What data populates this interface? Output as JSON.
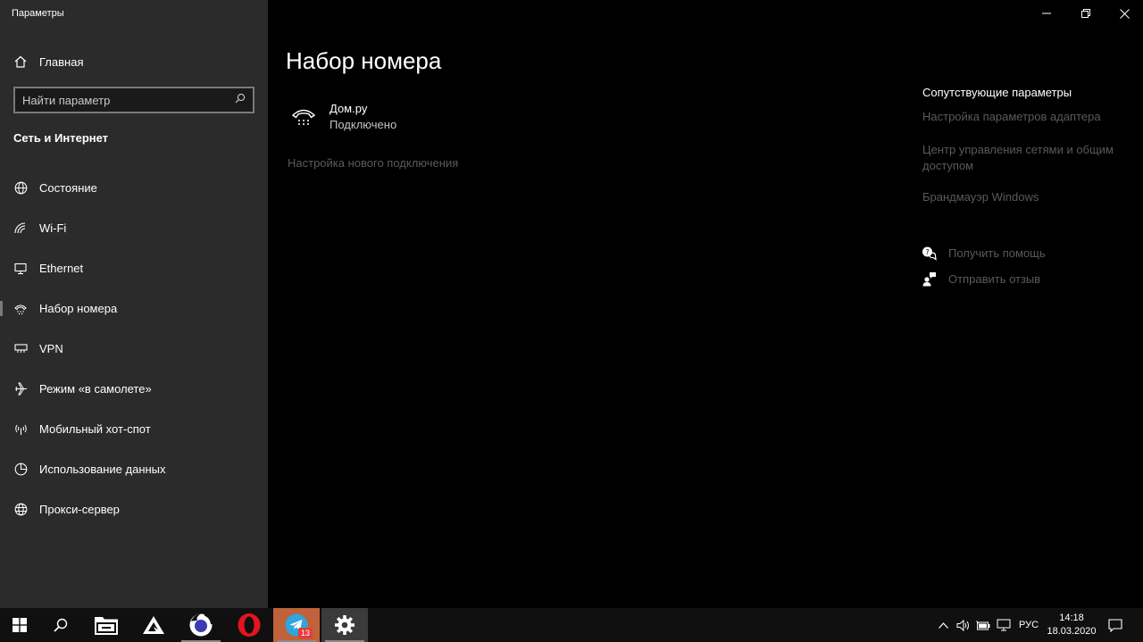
{
  "window": {
    "title": "Параметры"
  },
  "sidebar": {
    "home_label": "Главная",
    "search_placeholder": "Найти параметр",
    "section_title": "Сеть и Интернет",
    "items": [
      {
        "label": "Состояние",
        "icon": "globe-icon"
      },
      {
        "label": "Wi-Fi",
        "icon": "wifi-icon"
      },
      {
        "label": "Ethernet",
        "icon": "ethernet-icon"
      },
      {
        "label": "Набор номера",
        "icon": "dialup-icon",
        "selected": true
      },
      {
        "label": "VPN",
        "icon": "vpn-icon"
      },
      {
        "label": "Режим «в самолете»",
        "icon": "airplane-icon"
      },
      {
        "label": "Мобильный хот-спот",
        "icon": "hotspot-icon"
      },
      {
        "label": "Использование данных",
        "icon": "data-usage-icon"
      },
      {
        "label": "Прокси-сервер",
        "icon": "proxy-globe-icon"
      }
    ]
  },
  "main": {
    "title": "Набор номера",
    "connection": {
      "name": "Дом.ру",
      "status": "Подключено",
      "icon": "dialup-phone-icon"
    },
    "new_connection_link": "Настройка нового подключения"
  },
  "related": {
    "title": "Сопутствующие параметры",
    "links": [
      "Настройка параметров адаптера",
      "Центр управления сетями и общим доступом",
      "Брандмауэр Windows"
    ],
    "help_label": "Получить помощь",
    "feedback_label": "Отправить отзыв"
  },
  "taskbar": {
    "apps": [
      "start-icon",
      "search-icon",
      "file-explorer-icon",
      "aimp-icon",
      "firefox-icon",
      "opera-icon",
      "telegram-icon",
      "settings-icon"
    ],
    "telegram_badge": "13",
    "language": "РУС",
    "time": "14:18",
    "date": "18.03.2020"
  },
  "colors": {
    "sidebar_bg": "#2b2b2b",
    "main_bg": "#000000",
    "muted_link": "#5a5a5a",
    "taskbar_bg": "#101010",
    "telegram_active": "#c0623a"
  }
}
